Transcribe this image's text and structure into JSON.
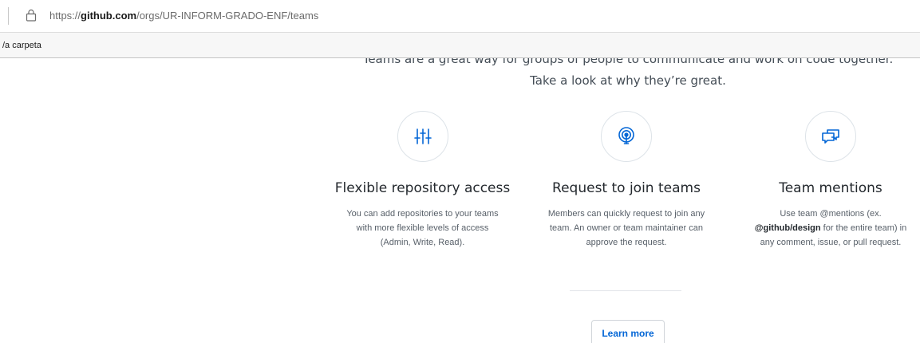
{
  "browser": {
    "url_prefix": "https://",
    "url_host": "github.com",
    "url_path": "/orgs/UR-INFORM-GRADO-ENF/teams",
    "bookmark_label": "/a carpeta"
  },
  "intro": {
    "line1": "Teams are a great way for groups of people to communicate and work on code together.",
    "line2": "Take a look at why they’re great."
  },
  "features": [
    {
      "icon": "sliders-icon",
      "title": "Flexible repository access",
      "desc_lines": [
        "You can add repositories to your teams",
        "with more flexible levels of access",
        "(Admin, Write, Read)."
      ]
    },
    {
      "icon": "broadcast-icon",
      "title": "Request to join teams",
      "desc_lines": [
        "Members can quickly request to join any",
        "team. An owner or team maintainer can",
        "approve the request."
      ]
    },
    {
      "icon": "comment-discussion-icon",
      "title": "Team mentions",
      "desc_line1": "Use team @mentions (ex.",
      "desc_line2_bold": "@github/design",
      "desc_line2_rest": " for the entire team) in",
      "desc_line3": "any comment, issue, or pull request."
    }
  ],
  "learn_more_label": "Learn more",
  "colors": {
    "accent": "#0366d6",
    "text": "#24292e",
    "muted": "#586069",
    "border": "#dde3e8"
  }
}
